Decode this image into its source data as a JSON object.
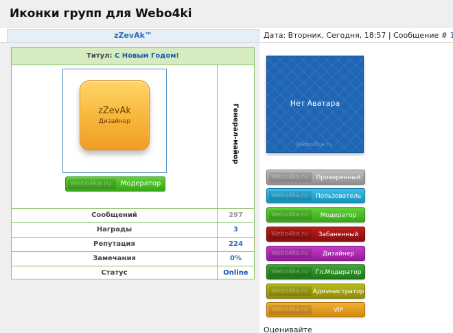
{
  "page": {
    "title": "Иконки групп для Webo4ki"
  },
  "post": {
    "username": "zZevAk™",
    "date_info": "Дата: Вторник, Сегодня, 18:57 | Сообщение # ",
    "message_number": "1"
  },
  "profile": {
    "title_label": "Титул: ",
    "title_value": "С Новым Годом!",
    "avatar": {
      "name": "zZevAk",
      "role": "Дизайнер"
    },
    "group_watermark": "Webo4ka.ru",
    "group_label": "Модератор",
    "rank": "Генерал-майор",
    "stats": [
      {
        "label": "Сообщений",
        "value": "297",
        "color": "#999999"
      },
      {
        "label": "Награды",
        "value": "3",
        "color": "#2a6db3"
      },
      {
        "label": "Репутация",
        "value": "224",
        "color": "#2a6db3"
      },
      {
        "label": "Замечания",
        "value": "0%",
        "color": "#2a6db3"
      },
      {
        "label": "Статус",
        "value": "Online",
        "color": "#1a4fb0"
      }
    ]
  },
  "no_avatar": {
    "text": "Нет Аватара",
    "watermark": "Webo4ka.ru"
  },
  "group_icons": [
    {
      "label": "Проверенный",
      "watermark": "Webo4ka.ru",
      "color_top": "#bdbdbd",
      "color_bottom": "#8f8f8f",
      "border": "#7a7a7a"
    },
    {
      "label": "Пользователь",
      "watermark": "Webo4ka.ru",
      "color_top": "#3fc1e8",
      "color_bottom": "#1492bd",
      "border": "#0f7aa0"
    },
    {
      "label": "Модератор",
      "watermark": "Webo4ka.ru",
      "color_top": "#5ed138",
      "color_bottom": "#3aa519",
      "border": "#2f8a13"
    },
    {
      "label": "Забаненный",
      "watermark": "Webo4ka.ru",
      "color_top": "#c01e1e",
      "color_bottom": "#8a0c0c",
      "border": "#6f0808"
    },
    {
      "label": "Дизайнер",
      "watermark": "Webo4ka.ru",
      "color_top": "#c43ec7",
      "color_bottom": "#961c99",
      "border": "#7a1480"
    },
    {
      "label": "Гл.Модератор",
      "watermark": "Webo4ka.ru",
      "color_top": "#3ea535",
      "color_bottom": "#1f7a18",
      "border": "#186412"
    },
    {
      "label": "Администратор",
      "watermark": "Webo4ka.ru",
      "color_top": "#b9b91c",
      "color_bottom": "#8f8f0a",
      "border": "#737306"
    },
    {
      "label": "VIP",
      "watermark": "Webo4ka.ru",
      "color_top": "#f2b035",
      "color_bottom": "#d28a10",
      "border": "#b0720a"
    }
  ],
  "footer": {
    "rate_label": "Оценивайте"
  }
}
